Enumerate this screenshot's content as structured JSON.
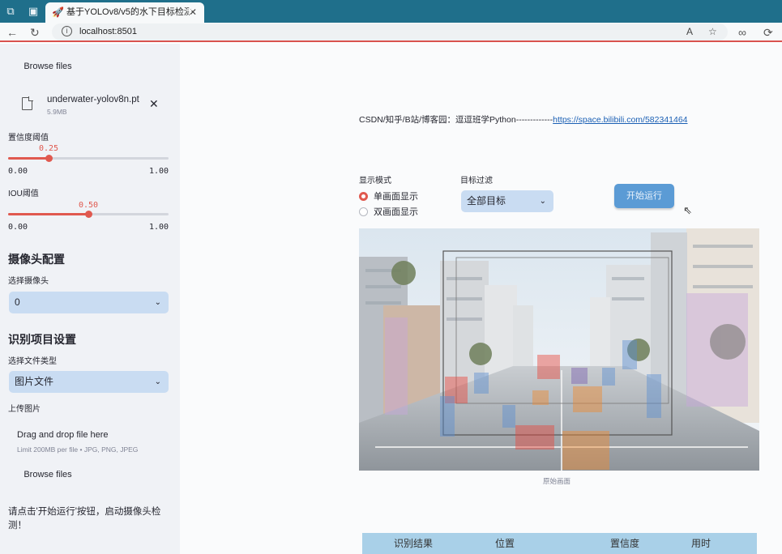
{
  "browser": {
    "tab_title": "基于YOLOv8/v5的水下目标检测系",
    "tab_close": "✕",
    "new_tab": "+",
    "url": "localhost:8501"
  },
  "sidebar": {
    "browse_label_top": "Browse files",
    "file": {
      "name": "underwater-yolov8n.pt",
      "size": "5.9MB"
    },
    "confidence": {
      "label": "置信度阈值",
      "value": "0.25",
      "min": "0.00",
      "max": "1.00",
      "fraction": 0.25
    },
    "iou": {
      "label": "IOU阈值",
      "value": "0.50",
      "min": "0.00",
      "max": "1.00",
      "fraction": 0.5
    },
    "camera_section": "摄像头配置",
    "camera_label": "选择摄像头",
    "camera_value": "0",
    "project_section": "识别项目设置",
    "file_type_label": "选择文件类型",
    "file_type_value": "图片文件",
    "upload_label": "上传图片",
    "drop_title": "Drag and drop file here",
    "drop_limit": "Limit 200MB per file • JPG, PNG, JPEG",
    "browse_label": "Browse files",
    "hint": "请点击'开始运行'按钮，启动摄像头检测！"
  },
  "main": {
    "credit_prefix": "CSDN/知乎/B站/博客园：逗逗班学Python-------------",
    "credit_link": "https://space.bilibili.com/582341464",
    "display_mode_label": "显示模式",
    "display_options": [
      "单画面显示",
      "双画面显示"
    ],
    "display_selected": 0,
    "target_filter_label": "目标过滤",
    "target_filter_value": "全部目标",
    "run_button": "开始运行",
    "image_caption": "原始画面",
    "table_headers": [
      "识别结果",
      "位置",
      "置信度",
      "用时"
    ]
  },
  "colors": {
    "accent": "#e0594f",
    "select_bg": "#c9dcf2",
    "run_button": "#5b9bd5",
    "table_header": "#a9d0e8",
    "sidebar_bg": "#f0f2f6",
    "tab_bar": "#1f6f8b"
  }
}
